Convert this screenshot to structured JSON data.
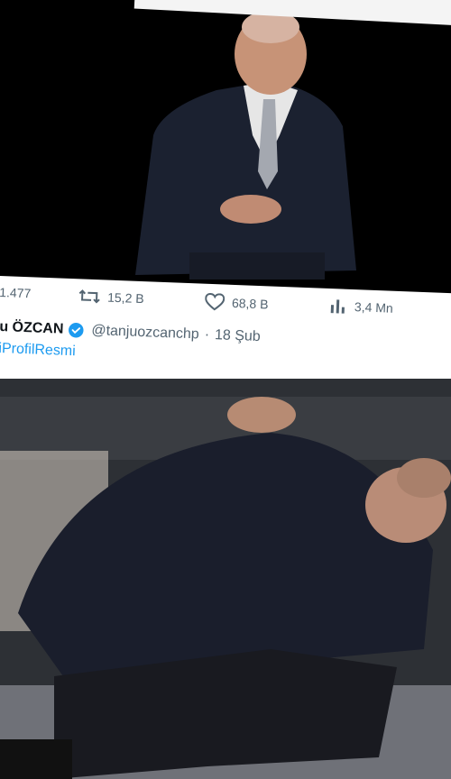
{
  "top_media": {
    "alt": "man standing in dark suit"
  },
  "actions": {
    "reply_count": "1.477",
    "retweet_count": "15,2 B",
    "like_count": "68,8 B",
    "views_count": "3,4 Mn"
  },
  "tweet": {
    "author_name": "u ÖZCAN",
    "handle": "@tanjuozcanchp",
    "time": "18 Şub",
    "hashtag": "iProfilResmi"
  },
  "colors": {
    "text_secondary": "#536471",
    "link": "#1d9bf0",
    "verified": "#1d9bf0"
  },
  "icons": [
    "reply-icon",
    "retweet-icon",
    "heart-icon",
    "views-icon",
    "verified-icon"
  ]
}
